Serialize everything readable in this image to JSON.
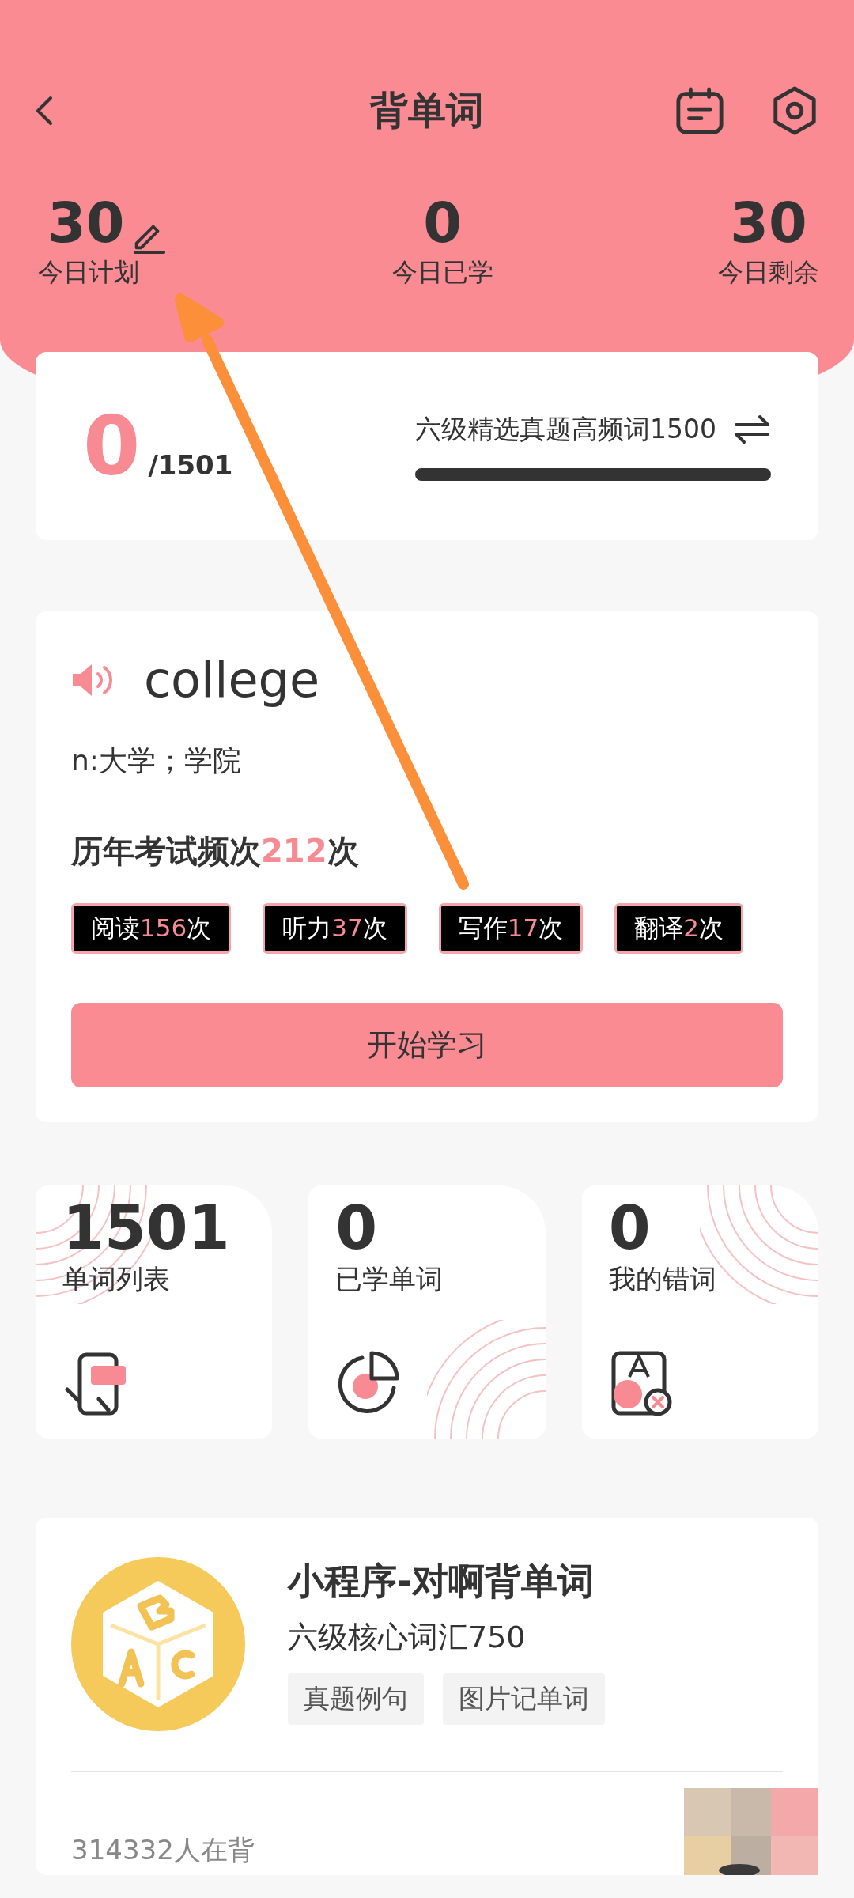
{
  "header": {
    "title": "背单词"
  },
  "stats": [
    {
      "value": "30",
      "label": "今日计划",
      "editable": true
    },
    {
      "value": "0",
      "label": "今日已学",
      "editable": false
    },
    {
      "value": "30",
      "label": "今日剩余",
      "editable": false
    }
  ],
  "progress_card": {
    "learned": "0",
    "total": "/1501",
    "book": "六级精选真题高频词1500"
  },
  "word_card": {
    "word": "college",
    "meaning": "n:大学；学院",
    "frequency": {
      "prefix": "历年考试频次",
      "count": "212",
      "suffix": "次"
    },
    "tags": [
      {
        "label": "阅读",
        "count": "156",
        "unit": "次"
      },
      {
        "label": "听力",
        "count": "37",
        "unit": "次"
      },
      {
        "label": "写作",
        "count": "17",
        "unit": "次"
      },
      {
        "label": "翻译",
        "count": "2",
        "unit": "次"
      }
    ],
    "button": "开始学习"
  },
  "tiles": [
    {
      "kind": "list",
      "value": "1501",
      "label": "单词列表"
    },
    {
      "kind": "learned",
      "value": "0",
      "label": "已学单词"
    },
    {
      "kind": "mistakes",
      "value": "0",
      "label": "我的错词"
    }
  ],
  "promo": {
    "title": "小程序-对啊背单词",
    "subtitle": "六级核心词汇750",
    "chips": [
      "真题例句",
      "图片记单词"
    ],
    "learners": "314332人在背",
    "kind": "picture"
  }
}
